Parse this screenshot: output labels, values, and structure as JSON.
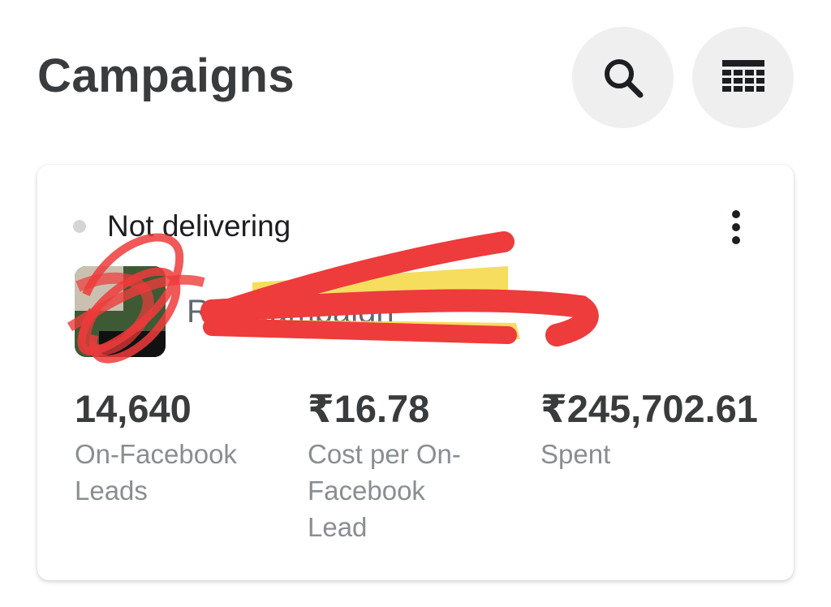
{
  "header": {
    "title": "Campaigns",
    "search_icon": "search-icon",
    "table_icon": "table-columns-icon"
  },
  "card": {
    "status": "Not delivering",
    "status_color": "#d3d5d8",
    "campaign_name": "R... Campaign",
    "more_icon": "more-vertical-icon",
    "metrics": [
      {
        "value": "14,640",
        "label": "On-Facebook Leads"
      },
      {
        "value": "₹16.78",
        "label": "Cost per On-Facebook Lead"
      },
      {
        "value": "₹245,702.61",
        "label": "Spent"
      }
    ]
  }
}
